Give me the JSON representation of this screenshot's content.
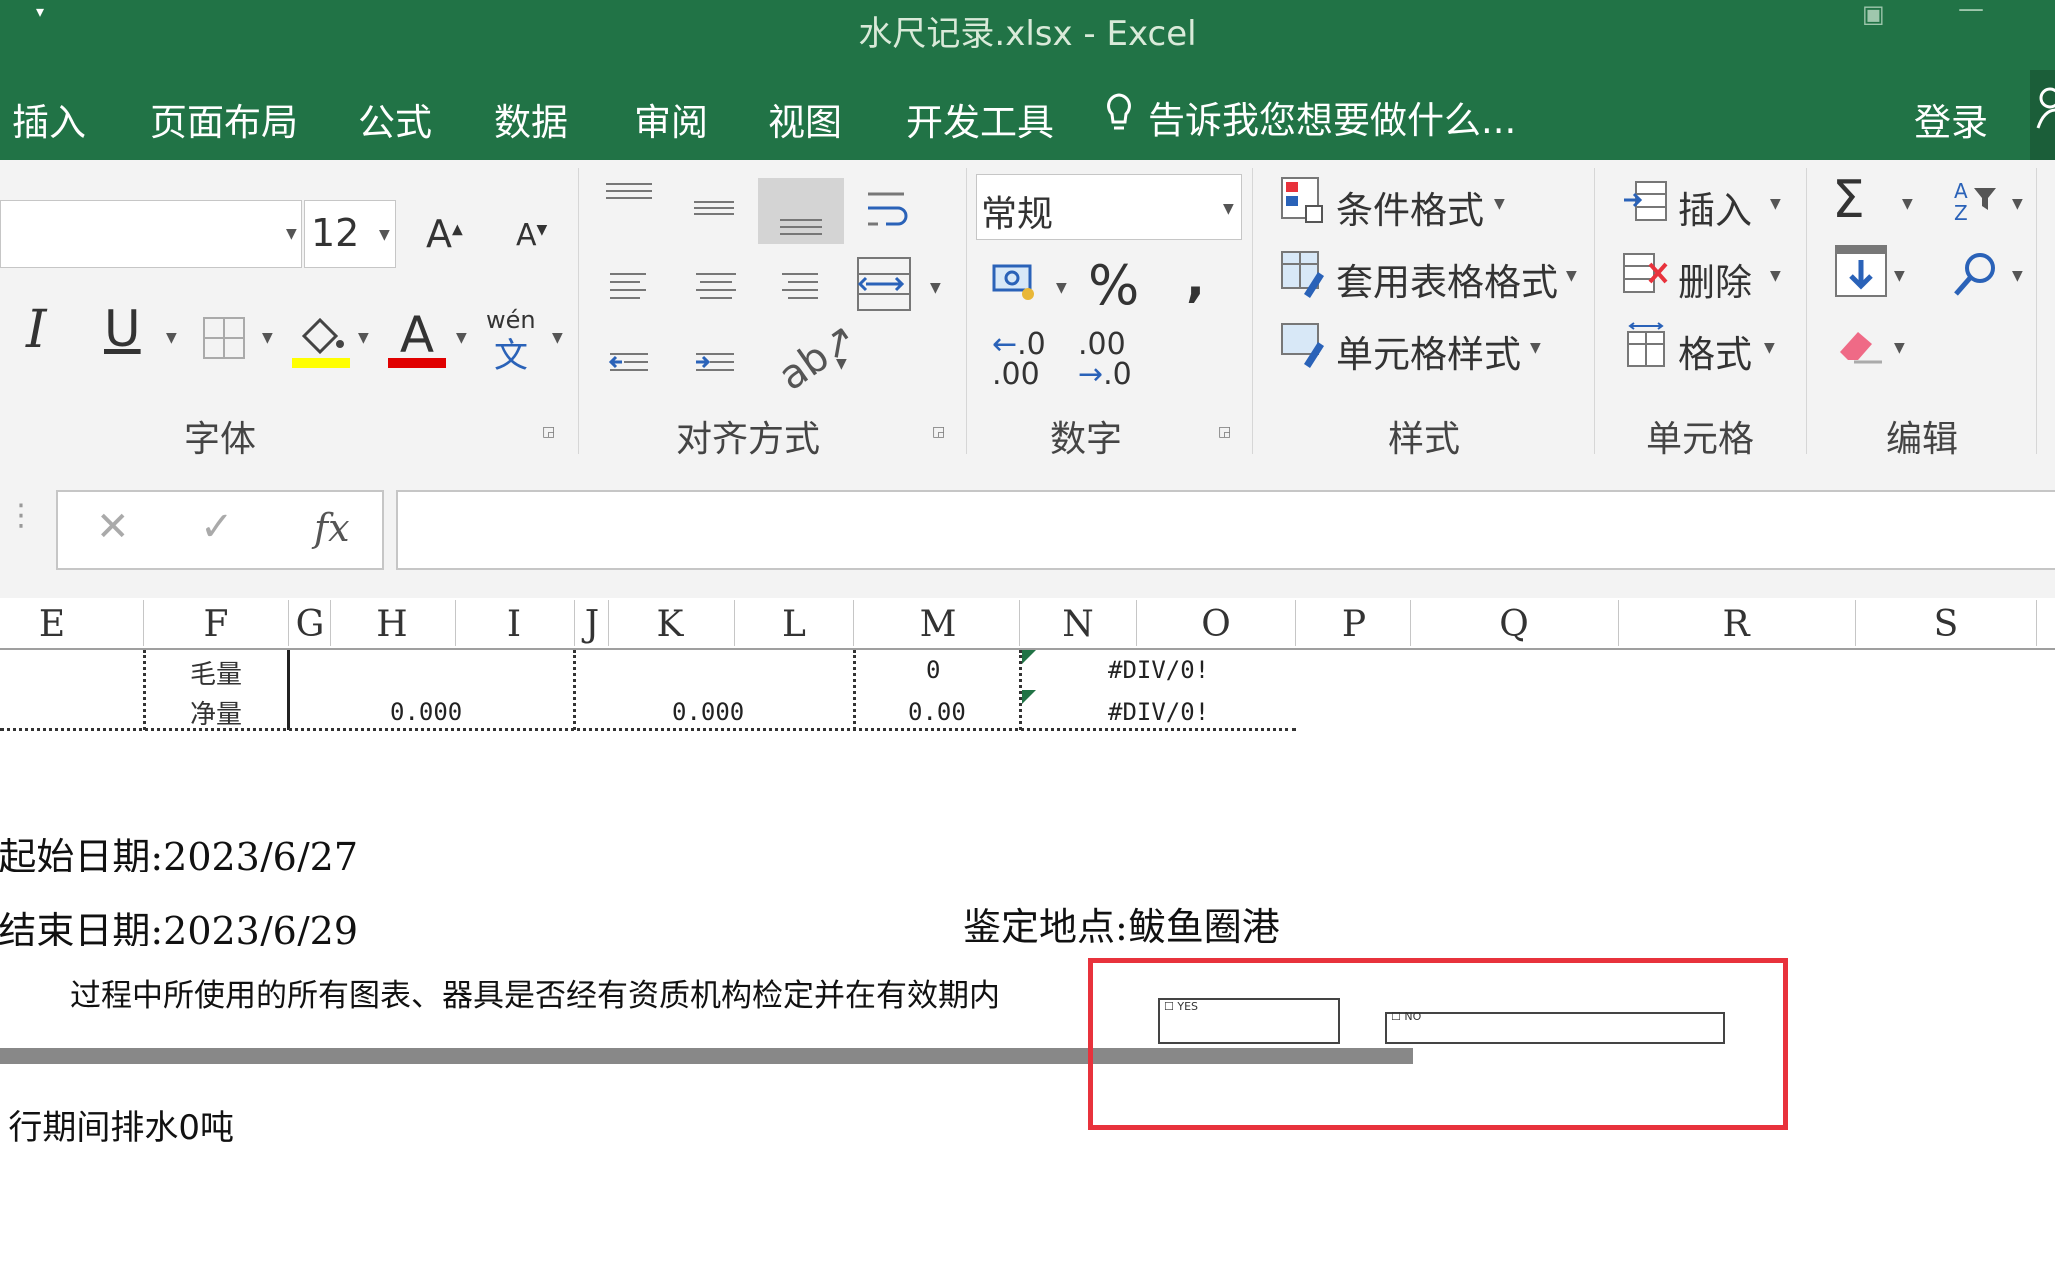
{
  "window": {
    "title": "水尺记录.xlsx - Excel"
  },
  "tabs": {
    "insert": "插入",
    "page_layout": "页面布局",
    "formulas": "公式",
    "data": "数据",
    "review": "审阅",
    "view": "视图",
    "developer": "开发工具",
    "tell_me": "告诉我您想要做什么...",
    "signin": "登录"
  },
  "ribbon": {
    "font": {
      "size": "12",
      "group": "字体"
    },
    "alignment": {
      "group": "对齐方式"
    },
    "number": {
      "format": "常规",
      "group": "数字"
    },
    "styles": {
      "conditional": "条件格式",
      "table": "套用表格格式",
      "cell_styles": "单元格样式",
      "group": "样式"
    },
    "cells": {
      "insert": "插入",
      "delete": "删除",
      "format": "格式",
      "group": "单元格"
    },
    "editing": {
      "group": "编辑"
    },
    "phonetic": "wén"
  },
  "formula_bar": {
    "fx": "fx",
    "value": ""
  },
  "columns": [
    "E",
    "F",
    "G",
    "H",
    "I",
    "J",
    "K",
    "L",
    "M",
    "N",
    "O",
    "P",
    "Q",
    "R",
    "S"
  ],
  "sheet": {
    "row1": {
      "label": "毛量",
      "m": "0",
      "o": "#DIV/0!"
    },
    "row2": {
      "label": "净量",
      "h": "0.000",
      "k": "0.000",
      "m": "0.00",
      "o": "#DIV/0!"
    },
    "start_date": "起始日期:2023/6/27",
    "end_date": "结束日期:2023/6/29",
    "location": "鉴定地点:鲅鱼圈港",
    "question": "过程中所使用的所有图表、器具是否经有资质机构检定并在有效期内",
    "yes": "YES",
    "no": "NO",
    "discharge": "行期间排水0吨"
  },
  "colors": {
    "excel_green": "#217346",
    "highlight_red": "#e8323c",
    "font_color_red": "#e00000",
    "fill_yellow": "#ffff00"
  }
}
